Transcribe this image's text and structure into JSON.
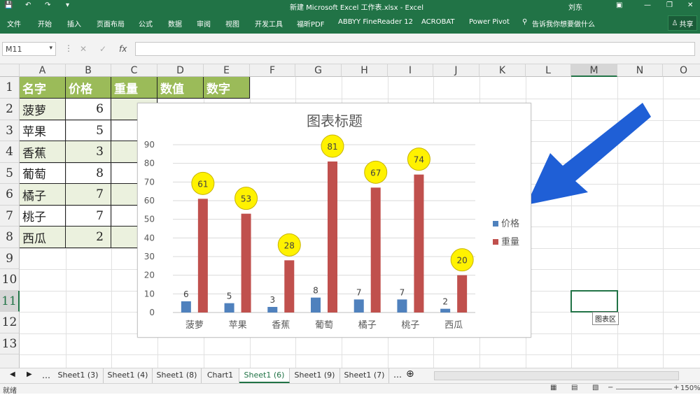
{
  "window": {
    "title": "新建 Microsoft Excel 工作表.xlsx  -  Excel",
    "user": "刘东"
  },
  "ribbon": {
    "tabs": [
      "文件",
      "开始",
      "插入",
      "页面布局",
      "公式",
      "数据",
      "审阅",
      "视图",
      "开发工具",
      "福昕PDF",
      "ABBYY FineReader 12",
      "ACROBAT",
      "Power Pivot"
    ],
    "tell_me": "告诉我你想要做什么",
    "share": "共享"
  },
  "formula_bar": {
    "name_box": "M11",
    "fx": "fx",
    "formula": ""
  },
  "columns": [
    "A",
    "B",
    "C",
    "D",
    "E",
    "F",
    "G",
    "H",
    "I",
    "J",
    "K",
    "L",
    "M",
    "N",
    "O"
  ],
  "rows": [
    "1",
    "2",
    "3",
    "4",
    "5",
    "6",
    "7",
    "8",
    "9",
    "10",
    "11",
    "12",
    "13"
  ],
  "table": {
    "headers": [
      "名字",
      "价格",
      "重量",
      "数值",
      "数字"
    ],
    "rows": [
      {
        "name": "菠萝",
        "price": "6"
      },
      {
        "name": "苹果",
        "price": "5"
      },
      {
        "name": "香蕉",
        "price": "3"
      },
      {
        "name": "葡萄",
        "price": "8"
      },
      {
        "name": "橘子",
        "price": "7"
      },
      {
        "name": "桃子",
        "price": "7"
      },
      {
        "name": "西瓜",
        "price": "2"
      }
    ]
  },
  "chart_data": {
    "type": "bar",
    "title": "图表标题",
    "categories": [
      "菠萝",
      "苹果",
      "香蕉",
      "葡萄",
      "橘子",
      "桃子",
      "西瓜"
    ],
    "series": [
      {
        "name": "价格",
        "values": [
          6,
          5,
          3,
          8,
          7,
          7,
          2
        ],
        "color": "#4f81bd"
      },
      {
        "name": "重量",
        "values": [
          61,
          53,
          28,
          81,
          67,
          74,
          20
        ],
        "color": "#c0504d"
      }
    ],
    "ylim": [
      0,
      90
    ],
    "yticks": [
      "0",
      "10",
      "20",
      "30",
      "40",
      "50",
      "60",
      "70",
      "80",
      "90"
    ],
    "legend": "right",
    "grid": true
  },
  "tooltip": "图表区",
  "sheet_tabs": [
    "Sheet1 (3)",
    "Sheet1 (4)",
    "Sheet1 (8)",
    "Chart1",
    "Sheet1 (6)",
    "Sheet1 (9)",
    "Sheet1 (7)"
  ],
  "active_sheet": "Sheet1 (6)",
  "status": {
    "mode": "就绪",
    "zoom": "150%"
  },
  "colors": {
    "excel_green": "#217346",
    "header_fill": "#9bbb59",
    "body_fill": "#ebf1de",
    "arrow": "#1f5fd6",
    "highlight": "#fff200"
  }
}
